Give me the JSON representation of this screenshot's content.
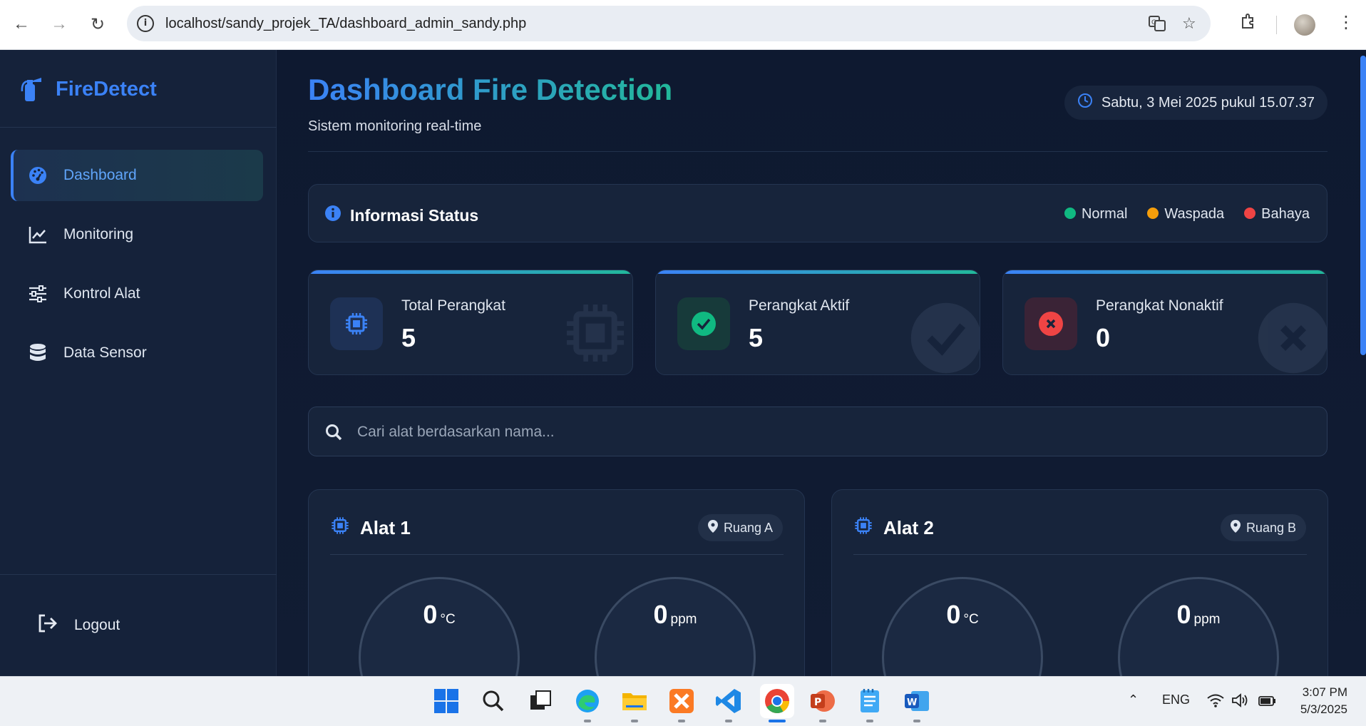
{
  "browser": {
    "url": "localhost/sandy_projek_TA/dashboard_admin_sandy.php"
  },
  "sidebar": {
    "brand": "FireDetect",
    "items": [
      {
        "label": "Dashboard",
        "icon": "gauge-icon",
        "active": true
      },
      {
        "label": "Monitoring",
        "icon": "chart-line-icon"
      },
      {
        "label": "Kontrol Alat",
        "icon": "sliders-icon"
      },
      {
        "label": "Data Sensor",
        "icon": "database-icon"
      }
    ],
    "logout": "Logout"
  },
  "header": {
    "title": "Dashboard Fire Detection",
    "subtitle": "Sistem monitoring real-time",
    "datetime": "Sabtu, 3 Mei 2025 pukul 15.07.37"
  },
  "status_info": {
    "title": "Informasi Status",
    "legend": [
      {
        "label": "Normal",
        "color": "#10b981"
      },
      {
        "label": "Waspada",
        "color": "#f59e0b"
      },
      {
        "label": "Bahaya",
        "color": "#ef4444"
      }
    ]
  },
  "stats": [
    {
      "label": "Total Perangkat",
      "value": "5",
      "icon": "chip-icon"
    },
    {
      "label": "Perangkat Aktif",
      "value": "5",
      "icon": "check-circle-icon"
    },
    {
      "label": "Perangkat Nonaktif",
      "value": "0",
      "icon": "x-circle-icon"
    }
  ],
  "search": {
    "placeholder": "Cari alat berdasarkan nama..."
  },
  "devices": [
    {
      "name": "Alat 1",
      "location": "Ruang A",
      "temp": "0",
      "temp_unit": "°C",
      "gas": "0",
      "gas_unit": "ppm"
    },
    {
      "name": "Alat 2",
      "location": "Ruang B",
      "temp": "0",
      "temp_unit": "°C",
      "gas": "0",
      "gas_unit": "ppm"
    }
  ],
  "taskbar": {
    "lang": "ENG",
    "time": "3:07 PM",
    "date": "5/3/2025"
  },
  "colors": {
    "accent": "#3b82f6",
    "accent2": "#22b89a",
    "success": "#10b981",
    "danger": "#ef4444",
    "background": "#0f1a2e"
  }
}
